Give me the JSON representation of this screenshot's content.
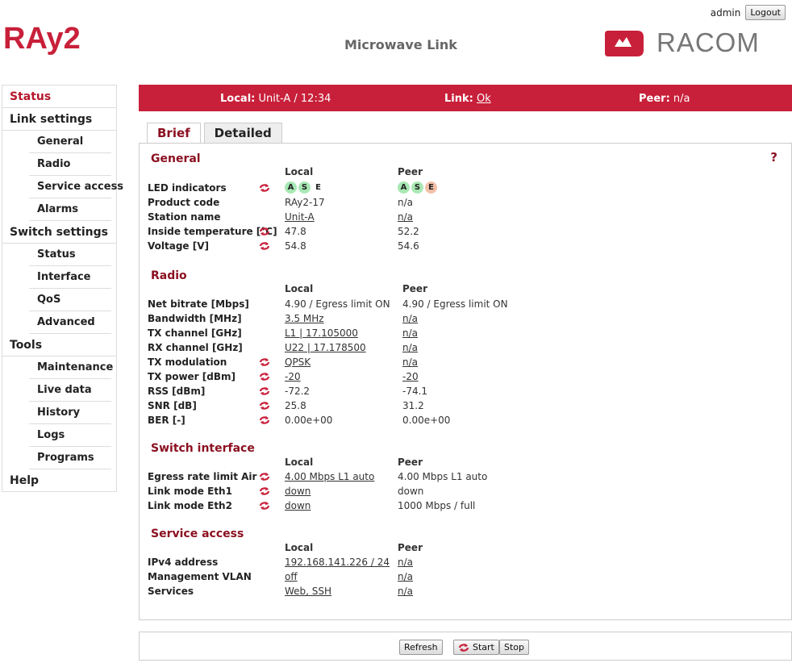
{
  "header": {
    "logo_left": "RAy2",
    "title": "Microwave Link",
    "user": "admin",
    "logout_label": "Logout",
    "logo_right": "RACOM"
  },
  "sidebar": {
    "cat_status": "Status",
    "cat_link": "Link settings",
    "link_items": [
      "General",
      "Radio",
      "Service access",
      "Alarms"
    ],
    "cat_switch": "Switch settings",
    "switch_items": [
      "Status",
      "Interface",
      "QoS",
      "Advanced"
    ],
    "cat_tools": "Tools",
    "tools_items": [
      "Maintenance",
      "Live data",
      "History",
      "Logs",
      "Programs"
    ],
    "cat_help": "Help"
  },
  "statusbar": {
    "local_label": "Local:",
    "local_value": "Unit-A / 12:34",
    "link_label": "Link:",
    "link_value": "Ok",
    "peer_label": "Peer:",
    "peer_value": "n/a"
  },
  "tabs": [
    "Brief",
    "Detailed"
  ],
  "help_label": "?",
  "columns": {
    "local": "Local",
    "peer": "Peer"
  },
  "general": {
    "title": "General",
    "led_label": "LED indicators",
    "leds_local": [
      "A",
      "S",
      "E"
    ],
    "leds_peer": [
      "A",
      "S",
      "E"
    ],
    "rows": [
      {
        "label": "Product code",
        "local": "RAy2-17",
        "peer": "n/a"
      },
      {
        "label": "Station name",
        "local": "Unit-A",
        "peer": "n/a"
      },
      {
        "label": "Inside temperature [°C]",
        "local": "47.8",
        "peer": "52.2"
      },
      {
        "label": "Voltage [V]",
        "local": "54.8",
        "peer": "54.6"
      }
    ]
  },
  "radio": {
    "title": "Radio",
    "rows": [
      {
        "label": "Net bitrate [Mbps]",
        "local": "4.90   / Egress limit ON",
        "peer": "4.90   / Egress limit ON"
      },
      {
        "label": "Bandwidth [MHz]",
        "local": "3.5 MHz",
        "peer": "n/a"
      },
      {
        "label": "TX channel [GHz]",
        "local": "L1 | 17.105000",
        "peer": "n/a"
      },
      {
        "label": "RX channel [GHz]",
        "local": "U22 | 17.178500",
        "peer": "n/a"
      },
      {
        "label": "TX modulation",
        "local": "QPSK",
        "peer": "n/a"
      },
      {
        "label": "TX power [dBm]",
        "local": "-20",
        "peer": "-20"
      },
      {
        "label": "RSS [dBm]",
        "local": "-72.2",
        "peer": "-74.1"
      },
      {
        "label": "SNR [dB]",
        "local": "25.8",
        "peer": "31.2"
      },
      {
        "label": "BER [-]",
        "local": "0.00e+00",
        "peer": "0.00e+00"
      }
    ]
  },
  "switch_interface": {
    "title": "Switch interface",
    "rows": [
      {
        "label": "Egress rate limit Air",
        "local": "4.00 Mbps L1 auto",
        "peer": "4.00 Mbps L1 auto"
      },
      {
        "label": "Link mode Eth1",
        "local": "down",
        "peer": "down"
      },
      {
        "label": "Link mode Eth2",
        "local": "down",
        "peer": "1000 Mbps / full"
      }
    ]
  },
  "service_access": {
    "title": "Service access",
    "rows": [
      {
        "label": "IPv4 address",
        "local": "192.168.141.226 / 24",
        "peer": "n/a"
      },
      {
        "label": "Management VLAN",
        "local": "off",
        "peer": "n/a"
      },
      {
        "label": "Services",
        "local": "Web, SSH",
        "peer": "n/a"
      }
    ]
  },
  "footer": {
    "refresh_label": "Refresh",
    "start_label": "Start",
    "stop_label": "Stop"
  },
  "colors": {
    "accent": "#c8203a",
    "dark_red": "#8b1020",
    "led_green": "#a8e8b4",
    "led_orange": "#f2c0a8"
  }
}
